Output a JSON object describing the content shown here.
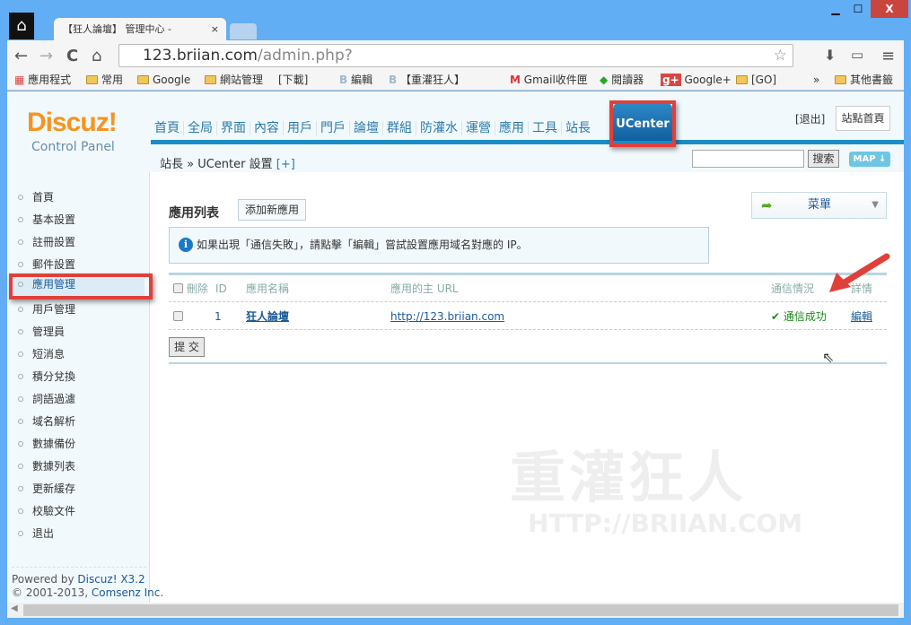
{
  "window": {
    "minimize": "▁",
    "maximize": "☐",
    "close": "X"
  },
  "tab": {
    "title": "【狂人論壇】 管理中心 - ",
    "close": "×"
  },
  "toolbar": {
    "back": "←",
    "forward": "→",
    "reload": "C",
    "home": "⌂",
    "url_host": "123.briian.com",
    "url_path": "/admin.php?",
    "menu": "≡"
  },
  "bookmarks": [
    "應用程式",
    "常用",
    "Google",
    "網站管理",
    "[下載]",
    "編輯",
    "【重灌狂人】",
    "Gmail收件匣",
    "閱讀器",
    "Google+",
    "[GO]",
    "»",
    "其他書籤"
  ],
  "header": {
    "logo": "Discuz!",
    "logo_sub": "Control Panel",
    "nav": [
      "首頁",
      "全局",
      "界面",
      "內容",
      "用戶",
      "門戶",
      "論壇",
      "群組",
      "防灌水",
      "運營",
      "應用",
      "工具",
      "站長"
    ],
    "active_nav": "UCenter",
    "logout": "[退出]",
    "site_home": "站點首頁",
    "breadcrumb": "站長 » UCenter 設置",
    "breadcrumb_plus": "[+]",
    "search_button": "搜索",
    "map": "MAP ↓"
  },
  "sidebar": {
    "items": [
      "首頁",
      "基本設置",
      "註冊設置",
      "郵件設置",
      "應用管理",
      "用戶管理",
      "管理員",
      "短消息",
      "積分兌換",
      "詞語過濾",
      "域名解析",
      "數據備份",
      "數據列表",
      "更新緩存",
      "校驗文件",
      "退出"
    ],
    "active": "應用管理",
    "powered": "Powered by ",
    "powered_link": "Discuz! X3.2",
    "copyright": "© 2001-2013, ",
    "copyright_link": "Comsenz Inc."
  },
  "main": {
    "title": "應用列表",
    "add_button": "添加新應用",
    "menu": "菜單",
    "tip": "如果出現「通信失敗」，請點擊「編輯」嘗試設置應用域名對應的 IP。",
    "columns": [
      "刪除",
      "ID",
      "應用名稱",
      "應用的主 URL",
      "通信情況",
      "詳情"
    ],
    "rows": [
      {
        "id": "1",
        "name": "狂人論壇",
        "url": "http://123.briian.com",
        "status": "通信成功",
        "action": "編輯"
      }
    ],
    "submit": "提 交"
  },
  "watermark": "重灌狂人",
  "watermark_url": "HTTP://BRIIAN.COM",
  "colors": {
    "accent": "#1a8cc6",
    "highlight_box": "#e0403a",
    "success": "#1a8a1a"
  }
}
